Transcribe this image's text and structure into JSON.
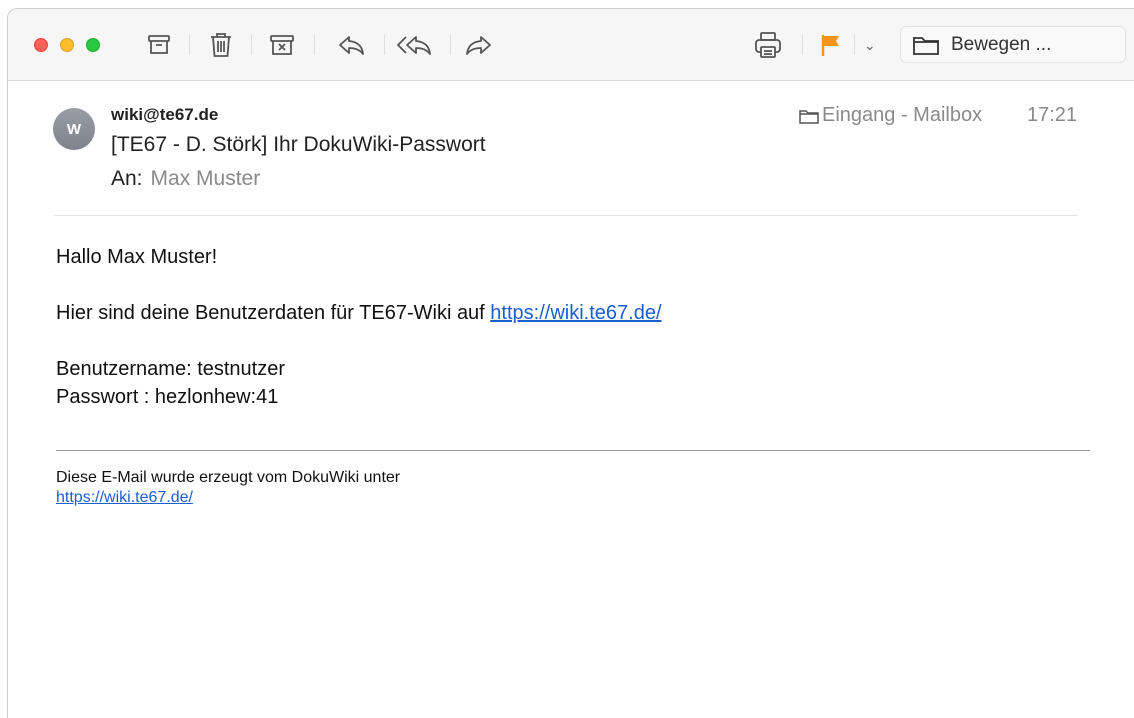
{
  "window": {
    "controls": [
      "close",
      "minimize",
      "zoom"
    ]
  },
  "toolbar": {
    "move_label": "Bewegen ..."
  },
  "colors": {
    "flag": "#f7941d",
    "link": "#1a5fd0",
    "traffic_red": "#ff5f57",
    "traffic_yellow": "#febc2e",
    "traffic_green": "#28c840"
  },
  "icons": [
    "archive-icon",
    "trash-icon",
    "junk-icon",
    "reply-icon",
    "reply-all-icon",
    "forward-icon",
    "print-icon",
    "flag-icon",
    "chevron-down-icon",
    "folder-icon"
  ],
  "message": {
    "avatar_initial": "W",
    "from": "wiki@te67.de",
    "subject": "[TE67 - D. Störk] Ihr DokuWiki-Passwort",
    "to_label": "An:",
    "to_value": "Max Muster",
    "mailbox": "Eingang - Mailbox",
    "time": "17:21"
  },
  "body": {
    "greeting": "Hallo Max Muster!",
    "intro_text": "Hier sind deine Benutzerdaten für TE67-Wiki auf ",
    "intro_link": "https://wiki.te67.de/",
    "username_line": "Benutzername: testnutzer",
    "password_line": "Passwort : hezlonhew:41",
    "footer_text": "Diese E-Mail wurde erzeugt vom DokuWiki unter",
    "footer_link": "https://wiki.te67.de/"
  }
}
